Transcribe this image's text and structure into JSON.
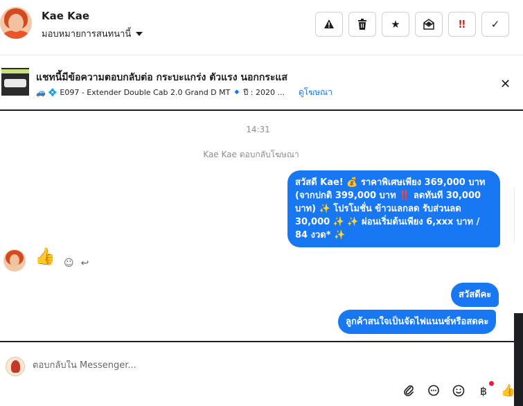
{
  "contact": {
    "name": "Kae Kae",
    "assign_label": "มอบหมายการสนทนานี้"
  },
  "actions": [
    {
      "name": "report-button",
      "icon": "⚠"
    },
    {
      "name": "delete-button",
      "icon": "🗑"
    },
    {
      "name": "star-button",
      "icon": "★"
    },
    {
      "name": "mark-unread-button",
      "icon": "✉"
    },
    {
      "name": "priority-button",
      "icon": "‼"
    },
    {
      "name": "done-button",
      "icon": "✓"
    }
  ],
  "ad": {
    "title": "แชทนี้มีข้อความตอบกลับต่อ กระบะแกร่ง ตัวแรง นอกกระแส",
    "model": "🚙 💠 E097 - Extender Double Cab 2.0 Grand D MT",
    "year": "ปี : 2020 ...",
    "link": "ดูโฆษณา"
  },
  "conversation": {
    "time": "14:31",
    "replied_note": "Kae Kae ตอบกลับโฆษณา",
    "messages": [
      "สวัสดี Kae! 💰 ราคาพิเศษเพียง 369,000 บาท (จากปกติ 399,000 บาท ‼️ ลดทันที 30,000 บาท) ✨ โปรโมชั่น ข้าวแลกลด รับส่วนลด 30,000 ✨ ✨ ผ่อนเริ่มต้นเพียง 6,xxx บาท / 84 งวด* ✨",
      "สวัสดีคะ",
      "ลูกค้าสนใจเป็นจัดไฟแนนซ์หรือสดคะ"
    ],
    "like_icon": "👍"
  },
  "composer": {
    "placeholder": "ตอบกลับใน Messenger..."
  },
  "colors": {
    "accent": "#1877f2",
    "danger": "#d93025"
  }
}
